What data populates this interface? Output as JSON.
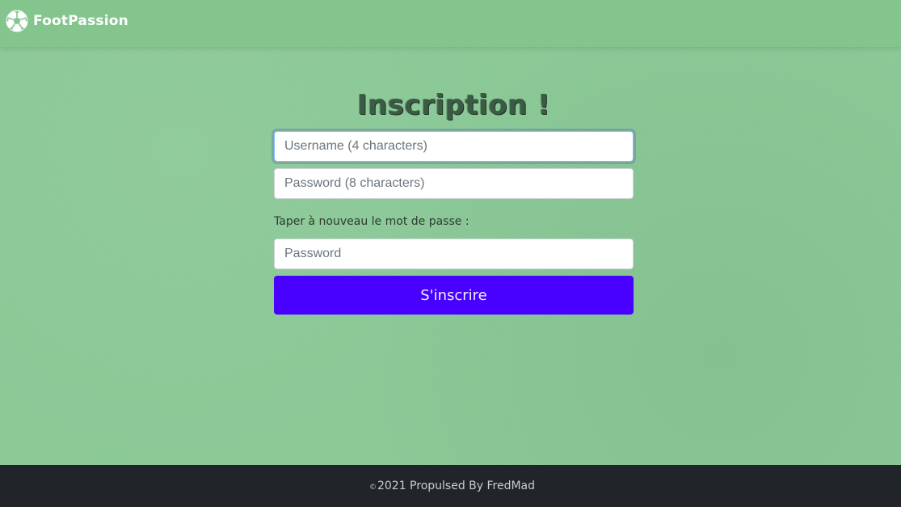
{
  "navbar": {
    "brand_name": "FootPassion",
    "brand_icon": "soccer-ball-icon",
    "background": "#83c58d"
  },
  "form": {
    "title": "Inscription !",
    "username_placeholder": "Username (4 characters)",
    "password_placeholder": "Password (8 characters)",
    "confirm_label": "Taper à nouveau le mot de passe :",
    "confirm_placeholder": "Password",
    "submit_label": "S'inscrire",
    "submit_color": "#4800ff"
  },
  "footer": {
    "copyright_symbol": "©",
    "text": "2021 Propulsed By FredMad",
    "background": "#212429"
  }
}
